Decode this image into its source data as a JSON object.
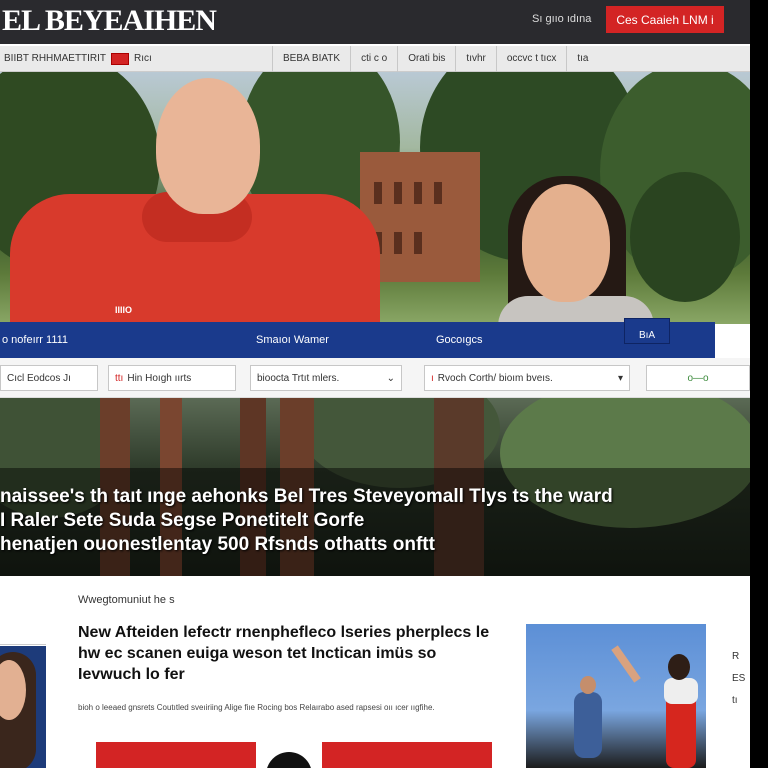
{
  "header": {
    "logo": "EL BEYEAIHEN",
    "sign_link": "Sı gııo ıdına",
    "cta_label": "Ces Caaieh LNM i"
  },
  "nav": {
    "left_text": "BIIBT RHHMAETTIRIT",
    "left_suffix": "Rıcı",
    "items": [
      "BEBA BIATK",
      "cti c o",
      "Orati bis",
      "tıvhr",
      "occvc t tıcx",
      "tıa"
    ]
  },
  "hero": {
    "shirt_tag": "IIIIO"
  },
  "category_strip": {
    "items": [
      "o nofeırr 1111",
      "Smaıoı Wamer",
      "Gocoıgcs"
    ],
    "badge": "BıA"
  },
  "filters": {
    "f1": "Cıcl Eodcos Jı",
    "f2_prefix": "ttı",
    "f2": "Hin Hoıgh ıırts",
    "f3": "bioocta Trtıt mlers.",
    "f4_prefix": "ı",
    "f4": "Rvoch Corth/ bioım bveıs.",
    "f5": "o—o"
  },
  "banner": {
    "line1": "naissee's th taıt ınge aehonks Bel Tres Steveyomall Tlys ts the ward",
    "line2": "I Raler Sete Suda Segse Ponetitelt Gorfe",
    "line3": "henatjen ouonestlentay 500 Rfsnds othatts onftt"
  },
  "article": {
    "kicker": "Wwegtomuniut he s",
    "headline": "New Afteiden lefectr rnenphefleco lseries pherplecs le hw ec scanen euiga weson tet Inctican imüs so Ievwuch lo fer",
    "summary": "bioh o leeaed gnsrets Coutıtled sveıiriing Alige fiıe Rocing bos Relaırabo ased rapsesi oıı ıcer ııgfihe.",
    "side_label_1": "R",
    "side_label_2": "ES",
    "side_label_3": "tı"
  }
}
